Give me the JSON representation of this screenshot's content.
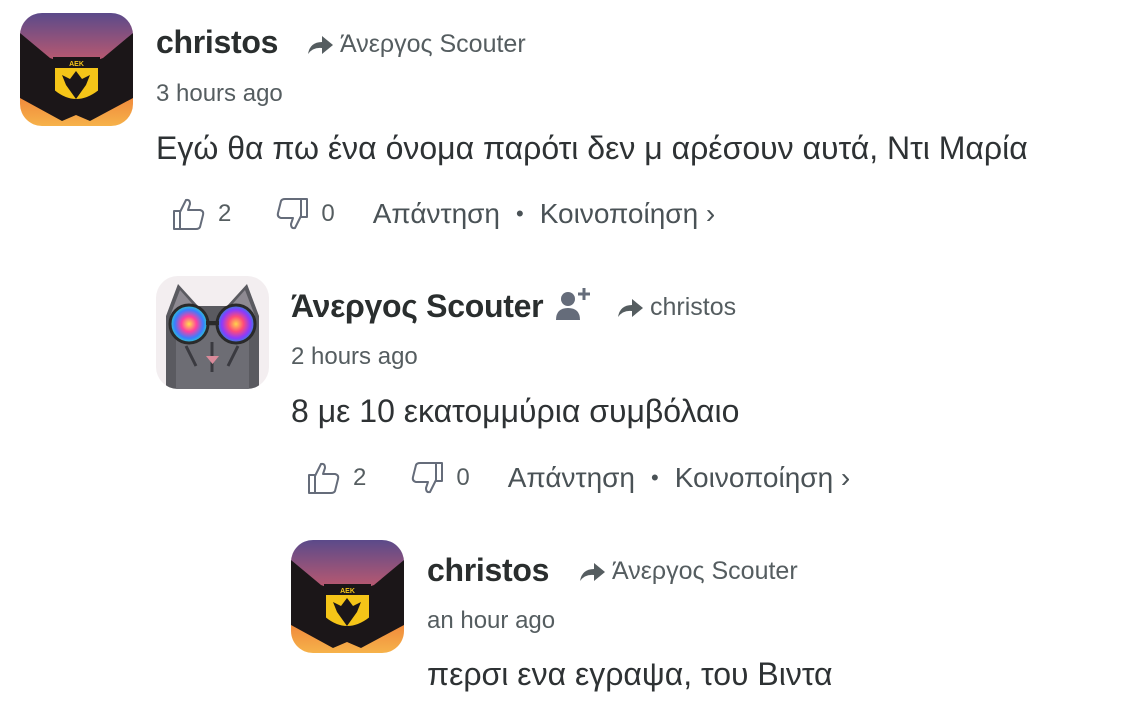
{
  "comments": [
    {
      "author": "christos",
      "reply_to": "Άνεργος Scouter",
      "time": "3 hours ago",
      "text": "Εγώ θα πω ένα όνομα παρότι δεν μ αρέσουν αυτά, Ντι Μαρία",
      "upvotes": "2",
      "downvotes": "0",
      "reply_label": "Απάντηση",
      "share_label": "Κοινοποίηση ›",
      "bullet": "•"
    },
    {
      "author": "Άνεργος Scouter",
      "reply_to": "christos",
      "time": "2 hours ago",
      "text": "8 με 10 εκατομμύρια συμβόλαιο",
      "upvotes": "2",
      "downvotes": "0",
      "reply_label": "Απάντηση",
      "share_label": "Κοινοποίηση ›",
      "bullet": "•"
    },
    {
      "author": "christos",
      "reply_to": "Άνεργος Scouter",
      "time": "an hour ago",
      "text": "περσι ενα εγραψα, του Βιντα"
    }
  ],
  "colors": {
    "text": "#2e3234",
    "meta": "#555d60",
    "icon": "#656c7a"
  },
  "icons": {
    "reply_arrow": "share-arrow-icon",
    "upvote": "thumbs-up-icon",
    "downvote": "thumbs-down-icon",
    "follow": "add-user-icon"
  }
}
